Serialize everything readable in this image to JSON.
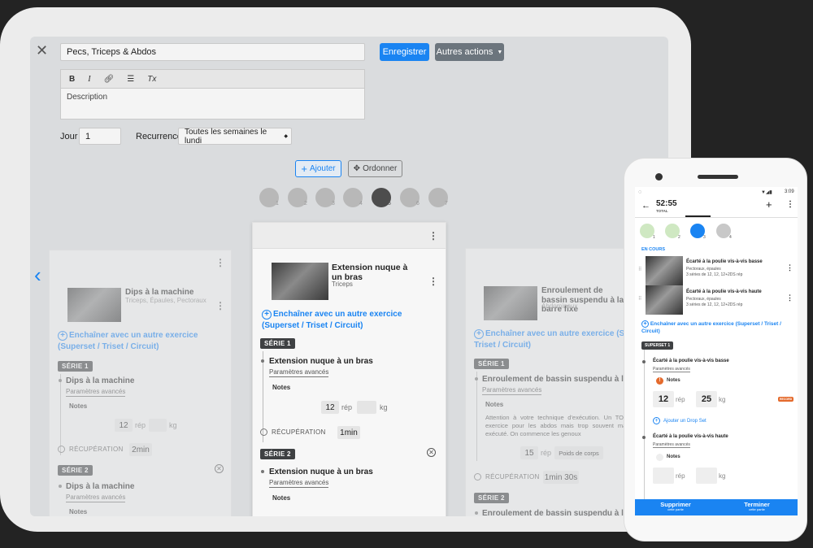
{
  "editor": {
    "title_value": "Pecs, Triceps & Abdos",
    "save_label": "Enregistrer",
    "more_actions_label": "Autres actions",
    "description_placeholder": "Description",
    "toolbar": {
      "bold": "B",
      "italic": "I",
      "link_icon": "link-icon",
      "list_icon": "list-icon",
      "clear_format": "Tx"
    },
    "day_label": "Jour",
    "day_value": "1",
    "recurrence_label": "Recurrence",
    "recurrence_value": "Toutes les semaines le lundi",
    "add_label": "Ajouter",
    "reorder_label": "Ordonner",
    "steps": [
      "1",
      "2",
      "3",
      "4",
      "5",
      "6",
      "7"
    ],
    "active_step": "5"
  },
  "cards": {
    "left": {
      "name": "Dips à la machine",
      "muscles": "Triceps, Épaules, Pectoraux",
      "chain": "Enchaîner avec un autre exercice (Superset / Triset / Circuit)",
      "serie1": "SÉRIE 1",
      "row1_name": "Dips à la machine",
      "advanced": "Paramètres avancés",
      "notes": "Notes",
      "reps": "12",
      "reps_unit": "rép",
      "kg_unit": "kg",
      "recup_label": "RÉCUPÉRATION",
      "recup_value": "2min",
      "serie2": "SÉRIE 2",
      "row2_name": "Dips à la machine",
      "advanced2": "Paramètres avancés",
      "notes2": "Notes"
    },
    "center": {
      "name": "Extension nuque à un bras",
      "muscles": "Triceps",
      "chain": "Enchaîner avec un autre exercice (Superset / Triset / Circuit)",
      "serie1": "SÉRIE 1",
      "row1_name": "Extension nuque à un bras",
      "advanced": "Paramètres avancés",
      "notes": "Notes",
      "reps": "12",
      "reps_unit": "rép",
      "kg_unit": "kg",
      "recup_label": "RÉCUPÉRATION",
      "recup_value": "1min",
      "serie2": "SÉRIE 2",
      "row2_name": "Extension nuque à un bras",
      "advanced2": "Paramètres avancés",
      "notes2": "Notes"
    },
    "right": {
      "name": "Enroulement de bassin suspendu à la barre fixe",
      "muscles": "Abdominaux",
      "chain": "Enchaîner avec un autre exercice (Superset / Triset / Circuit)",
      "serie1": "SÉRIE 1",
      "row1_name": "Enroulement de bassin suspendu à la barre fixe",
      "advanced": "Paramètres avancés",
      "notes": "Notes",
      "note_text": "Attention à votre technique d'exécution. Un TOP exercice pour les abdos mais trop souvent mal exécuté. On commence les genoux",
      "reps": "15",
      "reps_unit": "rép",
      "weight_label": "Poids de corps",
      "recup_label": "RÉCUPÉRATION",
      "recup_value": "1min 30s",
      "serie2": "SÉRIE 2",
      "row2_name": "Enroulement de bassin suspendu à la barre fixe"
    }
  },
  "phone": {
    "status_time": "3:09",
    "timer": "52:55",
    "timer_label": "TOTAL",
    "steps": [
      "1",
      "2",
      "3",
      "4"
    ],
    "in_progress": "EN COURS",
    "ex1_name": "Écarté à la poulie vis-à-vis basse",
    "ex1_muscles": "Pectoraux, épaules",
    "ex1_sets": "3 séries de 12, 12, 12+2DS rép",
    "ex2_name": "Écarté à la poulie vis-à-vis haute",
    "ex2_muscles": "Pectoraux, épaules",
    "ex2_sets": "3 séries de 12, 12, 12+2DS rép",
    "chain": "Enchaîner avec un autre exercice (Superset / Triset / Circuit)",
    "superset": "SUPERSET 1",
    "row1_name": "Écarté à la poulie vis-à-vis basse",
    "advanced": "Paramètres avancés",
    "notes": "Notes",
    "reps": "12",
    "reps_unit": "rép",
    "kg": "25",
    "kg_unit": "kg",
    "record": "RECORD",
    "drop_set": "Ajouter un Drop Set",
    "row2_name": "Écarté à la poulie vis-à-vis haute",
    "advanced2": "Paramètres avancés",
    "notes2": "Notes",
    "reps_unit2": "rép",
    "kg_unit2": "kg",
    "delete_label": "Supprimer",
    "delete_sub": "cette partie",
    "finish_label": "Terminer",
    "finish_sub": "cette partie"
  },
  "colors": {
    "accent": "#1a84f2",
    "active_step": "#4d4d4d",
    "done_step": "#cfe8c2"
  }
}
